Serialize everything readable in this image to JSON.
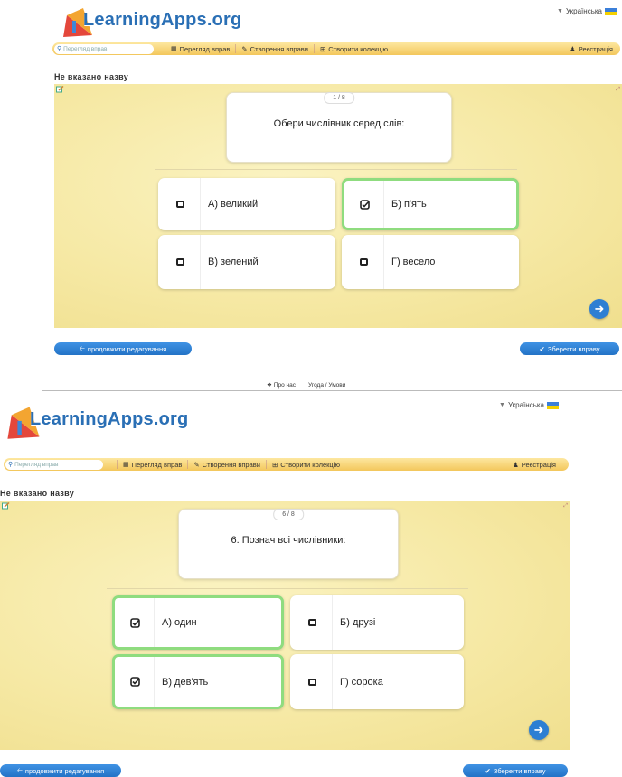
{
  "brand": {
    "logo_text": "LearningApps.org"
  },
  "language": {
    "label": "Українська"
  },
  "navbar": {
    "search_placeholder": "Перегляд вправ",
    "browse": "Перегляд вправ",
    "create": "Створення вправи",
    "collection": "Створити колекцію",
    "register": "Реєстрація"
  },
  "page_title": "Не вказано назву",
  "screens": [
    {
      "counter": "1 / 8",
      "question": "Обери числівник серед слів:",
      "answers": [
        {
          "label": "А) великий",
          "selected": false
        },
        {
          "label": "Б) п'ять",
          "selected": true
        },
        {
          "label": "В) зелений",
          "selected": false
        },
        {
          "label": "Г) весело",
          "selected": false
        }
      ]
    },
    {
      "counter": "6 / 8",
      "question": "6. Познач всі числівники:",
      "answers": [
        {
          "label": "А) один",
          "selected": true
        },
        {
          "label": "Б) друзі",
          "selected": false
        },
        {
          "label": "В) дев'ять",
          "selected": true
        },
        {
          "label": "Г) сорока",
          "selected": false
        }
      ]
    }
  ],
  "buttons": {
    "continue_editing": "продовжити редагування",
    "save": "Зберегти вправу"
  },
  "footer": {
    "about": "Про нас",
    "terms": "Угода / Умови"
  },
  "colors": {
    "accent": "#2d7fd3",
    "nav": "#f3c75c",
    "selected_border": "#8fdc7f",
    "app_bg": "#f6e9a5"
  }
}
